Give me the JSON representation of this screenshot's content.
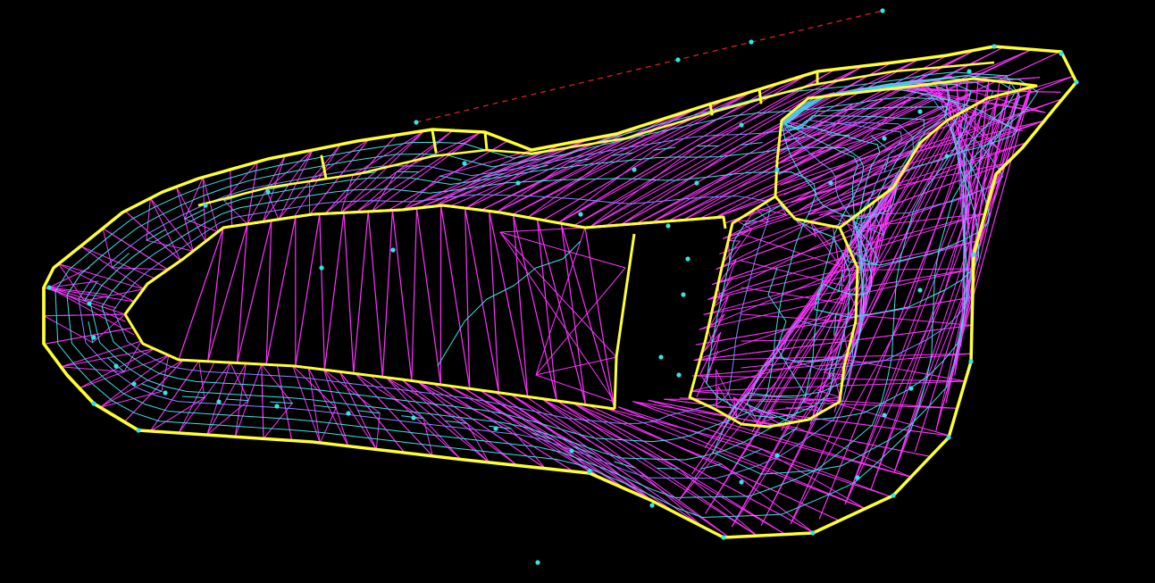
{
  "view": {
    "background": "#000000"
  },
  "colors": {
    "boundary": "#ffff33",
    "triangulation": "#ff33ff",
    "contour": "#33e6e6",
    "contour_alt": "#7f8cff",
    "survey_point": "#33e6e6",
    "baseline": "#cc1f1f"
  },
  "layers": [
    {
      "id": "boundary",
      "description_visible": false
    },
    {
      "id": "triangulation",
      "description_visible": false
    },
    {
      "id": "contours",
      "description_visible": false
    },
    {
      "id": "survey-points",
      "description_visible": false
    },
    {
      "id": "baseline",
      "description_visible": false
    }
  ]
}
